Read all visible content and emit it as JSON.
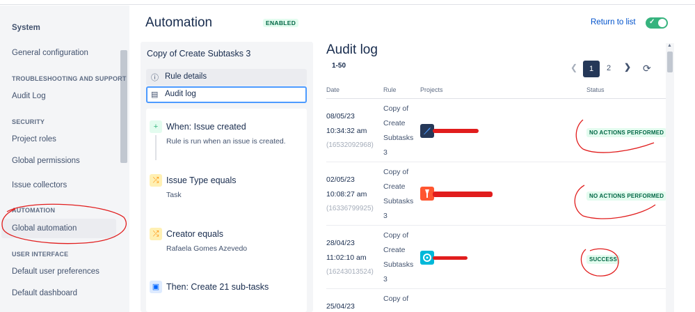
{
  "sidebar": {
    "title": "System",
    "items": [
      {
        "label": "General configuration"
      },
      {
        "section": "TROUBLESHOOTING AND SUPPORT"
      },
      {
        "label": "Audit Log"
      },
      {
        "section": "SECURITY"
      },
      {
        "label": "Project roles"
      },
      {
        "label": "Global permissions"
      },
      {
        "label": "Issue collectors"
      },
      {
        "section": "AUTOMATION"
      },
      {
        "label": "Global automation"
      },
      {
        "section": "USER INTERFACE"
      },
      {
        "label": "Default user preferences"
      },
      {
        "label": "Default dashboard"
      }
    ]
  },
  "header": {
    "title": "Automation",
    "status": "ENABLED",
    "return_link": "Return to list",
    "toggle_on": true
  },
  "rule": {
    "name": "Copy of Create Subtasks 3",
    "tabs": [
      {
        "label": "Rule details",
        "icon": "info-icon"
      },
      {
        "label": "Audit log",
        "icon": "document-icon",
        "selected": true
      }
    ],
    "steps": [
      {
        "title": "When: Issue created",
        "subtitle": "Rule is run when an issue is created.",
        "icon": "plus-icon",
        "color": "#36b37e"
      },
      {
        "title": "Issue Type equals",
        "subtitle": "Task",
        "icon": "shuffle-icon",
        "color": "#ffab00"
      },
      {
        "title": "Creator equals",
        "subtitle": "Rafaela Gomes Azevedo",
        "icon": "shuffle-icon",
        "color": "#ffab00"
      },
      {
        "title": "Then: Create 21 sub-tasks",
        "subtitle": "",
        "icon": "action-icon",
        "color": "#0065ff"
      }
    ]
  },
  "audit": {
    "title": "Audit log",
    "range": "1-50",
    "pagination": {
      "current": "1",
      "next": "2"
    },
    "columns": [
      "Date",
      "Rule",
      "Projects",
      "Status"
    ],
    "rows": [
      {
        "date": "08/05/23",
        "time": "10:34:32 am",
        "id": "(16532092968)",
        "rule": [
          "Copy of",
          "Create",
          "Subtasks",
          "3"
        ],
        "status": "NO ACTIONS PERFORMED"
      },
      {
        "date": "02/05/23",
        "time": "10:08:27 am",
        "id": "(16336799925)",
        "rule": [
          "Copy of",
          "Create",
          "Subtasks",
          "3"
        ],
        "status": "NO ACTIONS PERFORMED"
      },
      {
        "date": "28/04/23",
        "time": "11:02:10 am",
        "id": "(16243013524)",
        "rule": [
          "Copy of",
          "Create",
          "Subtasks",
          "3"
        ],
        "status": "SUCCESS"
      },
      {
        "date": "25/04/23",
        "time": "",
        "id": "",
        "rule": [
          "Copy of"
        ],
        "status": ""
      }
    ]
  },
  "colors": {
    "accent": "#0052cc",
    "success_bg": "#e3fcef",
    "success_text": "#006644",
    "annotation": "#e11d1d"
  }
}
